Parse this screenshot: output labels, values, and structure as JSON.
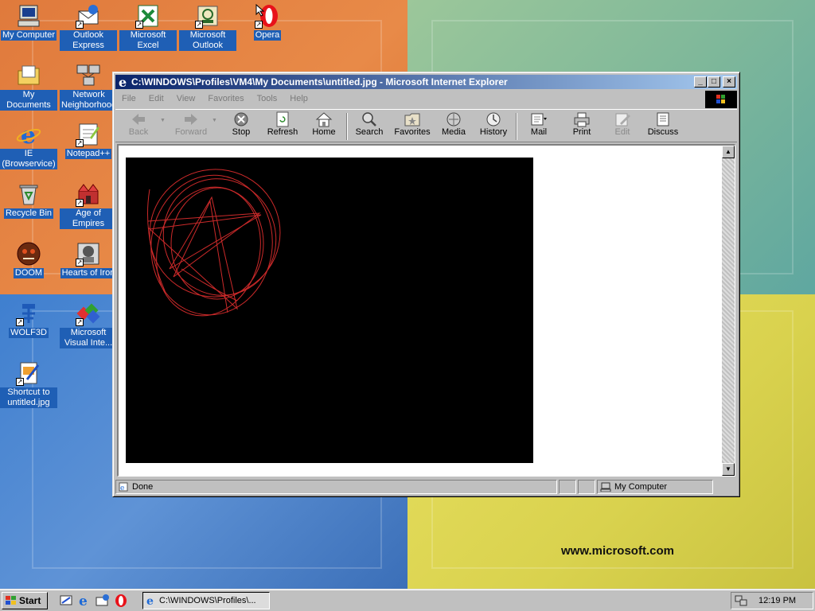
{
  "desktop": {
    "brand_text": "www.microsoft.com",
    "icons": [
      {
        "label": "My Computer",
        "icon": "my-computer-icon"
      },
      {
        "label": "Outlook Express",
        "icon": "outlook-express-icon"
      },
      {
        "label": "Microsoft Excel",
        "icon": "excel-icon"
      },
      {
        "label": "Microsoft Outlook",
        "icon": "outlook-icon"
      },
      {
        "label": "Opera",
        "icon": "opera-icon"
      },
      {
        "label": "My Documents",
        "icon": "my-documents-icon"
      },
      {
        "label": "Network Neighborhood",
        "icon": "network-icon"
      },
      {
        "label": "IE (Browservice)",
        "icon": "internet-explorer-icon"
      },
      {
        "label": "Notepad++",
        "icon": "notepad-icon"
      },
      {
        "label": "Recycle Bin",
        "icon": "recycle-bin-icon"
      },
      {
        "label": "Age of Empires",
        "icon": "age-of-empires-icon"
      },
      {
        "label": "DOOM",
        "icon": "doom-icon"
      },
      {
        "label": "Hearts of Iron",
        "icon": "hearts-of-iron-icon"
      },
      {
        "label": "WOLF3D",
        "icon": "wolf3d-icon"
      },
      {
        "label": "Microsoft Visual Inte...",
        "icon": "visual-interdev-icon"
      },
      {
        "label": "Shortcut to untitled.jpg",
        "icon": "image-shortcut-icon"
      }
    ]
  },
  "window": {
    "title": "C:\\WINDOWS\\Profiles\\VM4\\My Documents\\untitled.jpg - Microsoft Internet Explorer",
    "menu": [
      "File",
      "Edit",
      "View",
      "Favorites",
      "Tools",
      "Help"
    ],
    "toolbar": {
      "back": "Back",
      "forward": "Forward",
      "stop": "Stop",
      "refresh": "Refresh",
      "home": "Home",
      "search": "Search",
      "favorites": "Favorites",
      "media": "Media",
      "history": "History",
      "mail": "Mail",
      "print": "Print",
      "edit": "Edit",
      "discuss": "Discuss"
    },
    "status": {
      "text": "Done",
      "zone": "My Computer"
    },
    "image": {
      "background": "#000000",
      "stroke_color": "#cc2a2a"
    }
  },
  "taskbar": {
    "start_label": "Start",
    "task_label": "C:\\WINDOWS\\Profiles\\...",
    "clock": "12:19 PM"
  }
}
